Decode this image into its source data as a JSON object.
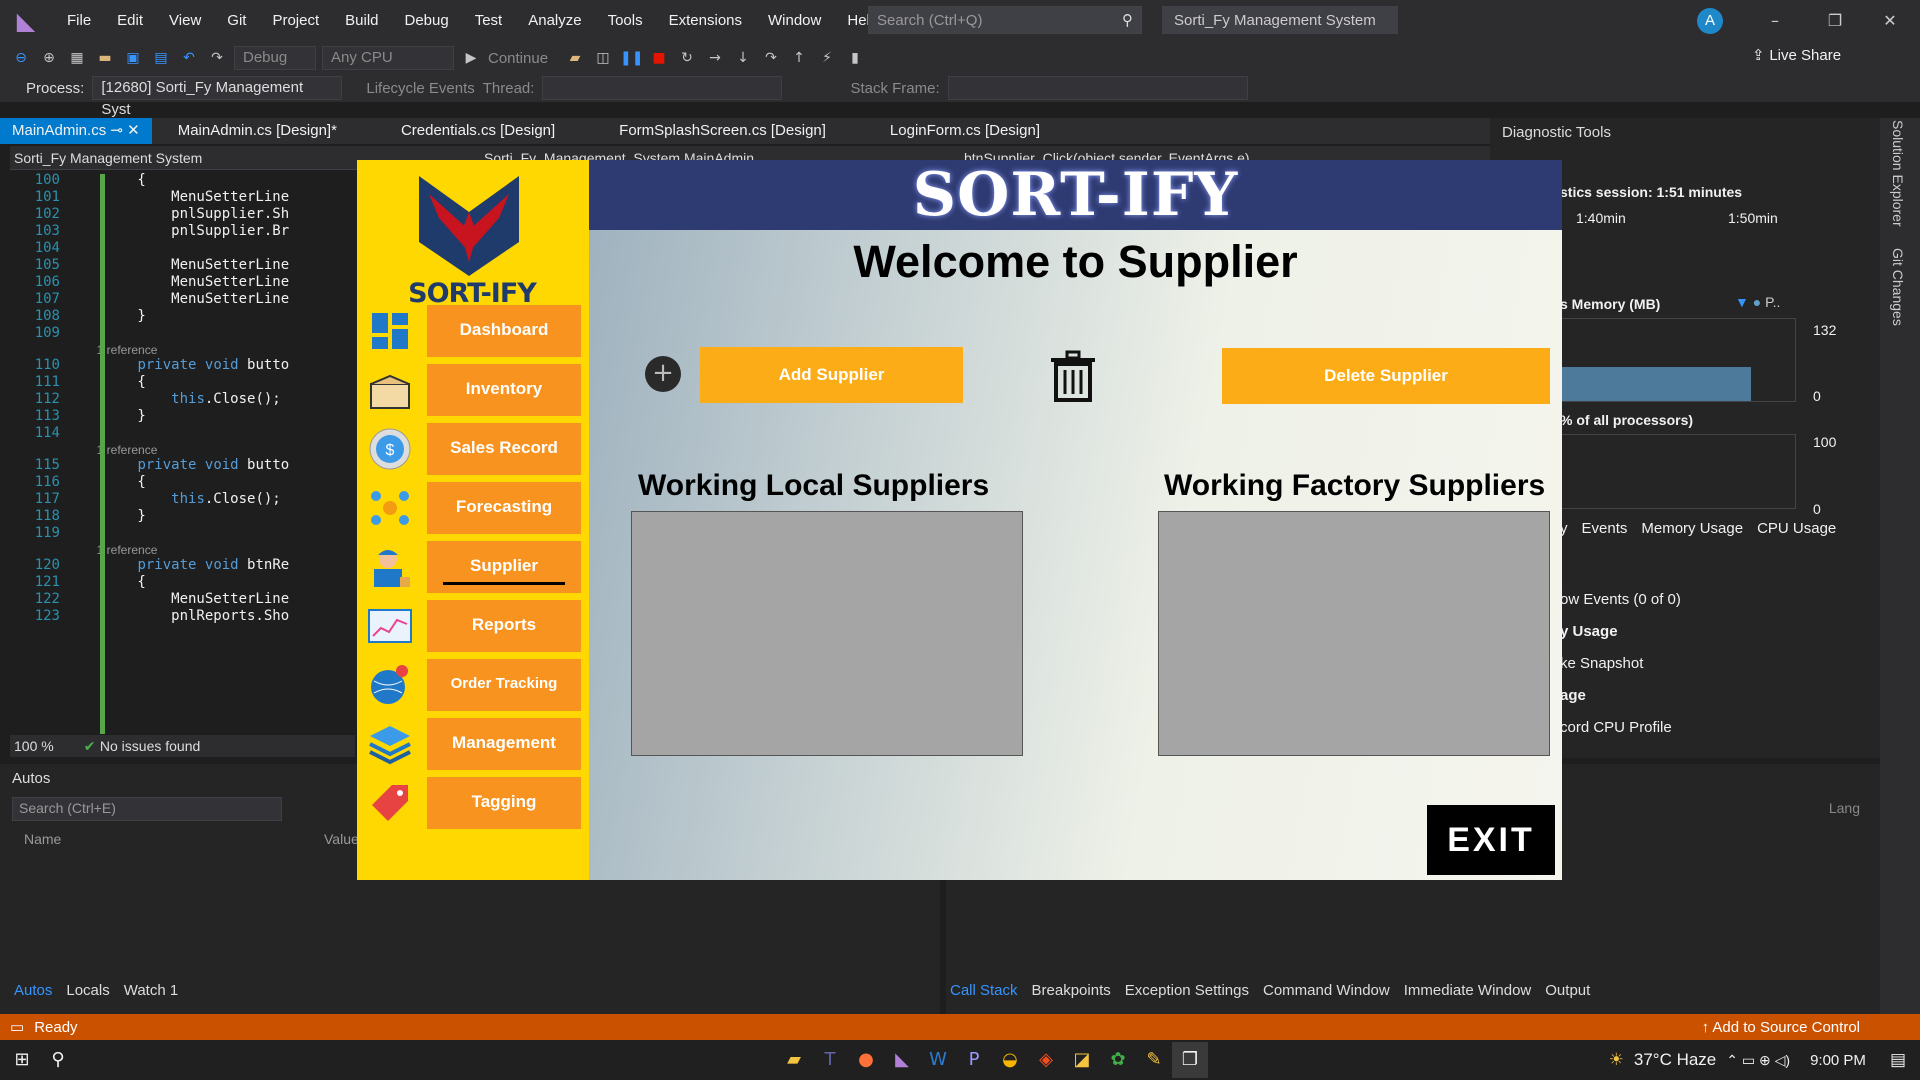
{
  "ide": {
    "menu": [
      "File",
      "Edit",
      "View",
      "Git",
      "Project",
      "Build",
      "Debug",
      "Test",
      "Analyze",
      "Tools",
      "Extensions",
      "Window",
      "Help"
    ],
    "search_placeholder": "Search (Ctrl+Q)",
    "solution_name": "Sorti_Fy Management System",
    "avatar_initial": "A",
    "live_share": "Live Share",
    "toolbar": {
      "config": "Debug",
      "platform": "Any CPU",
      "continue": "Continue"
    },
    "debug_bar": {
      "process_label": "Process:",
      "process_value": "[12680] Sorti_Fy Management Syst",
      "lifecycle": "Lifecycle Events",
      "thread": "Thread:",
      "stack_frame": "Stack Frame:"
    },
    "tabs": [
      "MainAdmin.cs",
      "MainAdmin.cs [Design]*",
      "Credentials.cs [Design]",
      "FormSplashScreen.cs [Design]",
      "LoginForm.cs [Design]"
    ],
    "nav": {
      "project": "Sorti_Fy Management System",
      "class": "Sorti_Fy_Management_System.MainAdmin",
      "member": "btnSupplier_Click(object sender, EventArgs e)"
    },
    "code": [
      {
        "n": "100",
        "t": "        {"
      },
      {
        "n": "101",
        "t": "            MenuSetterLine"
      },
      {
        "n": "102",
        "t": "            pnlSupplier.Sh"
      },
      {
        "n": "103",
        "t": "            pnlSupplier.Br"
      },
      {
        "n": "104",
        "t": ""
      },
      {
        "n": "105",
        "t": "            MenuSetterLine"
      },
      {
        "n": "106",
        "t": "            MenuSetterLine"
      },
      {
        "n": "107",
        "t": "            MenuSetterLine"
      },
      {
        "n": "108",
        "t": "        }"
      },
      {
        "n": "109",
        "t": ""
      },
      {
        "n": "110",
        "t": "        private void butto"
      },
      {
        "n": "111",
        "t": "        {"
      },
      {
        "n": "112",
        "t": "            this.Close();"
      },
      {
        "n": "113",
        "t": "        }"
      },
      {
        "n": "114",
        "t": ""
      },
      {
        "n": "115",
        "t": "        private void butto"
      },
      {
        "n": "116",
        "t": "        {"
      },
      {
        "n": "117",
        "t": "            this.Close();"
      },
      {
        "n": "118",
        "t": "        }"
      },
      {
        "n": "119",
        "t": ""
      },
      {
        "n": "120",
        "t": "        private void btnRe"
      },
      {
        "n": "121",
        "t": "        {"
      },
      {
        "n": "122",
        "t": "            MenuSetterLine"
      },
      {
        "n": "123",
        "t": "            pnlReports.Sho"
      }
    ],
    "ref_label": "1 reference",
    "zoom": "100 %",
    "issues": "No issues found",
    "autos": {
      "title": "Autos",
      "search": "Search (Ctrl+E)",
      "col_name": "Name",
      "col_value": "Value",
      "tabs": [
        "Autos",
        "Locals",
        "Watch 1"
      ]
    },
    "diag": {
      "title": "Diagnostic Tools",
      "session": "stics session: 1:51 minutes",
      "t1": "1:40min",
      "t2": "1:50min",
      "memory": "s Memory (MB)",
      "mem_legend": "P..",
      "mem_max": "132",
      "mem_min": "0",
      "cpu": "% of all processors)",
      "cpu_max": "100",
      "cpu_min": "0",
      "tabs": [
        "y",
        "Events",
        "Memory Usage",
        "CPU Usage"
      ],
      "rows": [
        "ow Events (0 of 0)",
        "y Usage",
        "ke Snapshot",
        "age",
        "cord CPU Profile"
      ]
    },
    "bottom_right_tabs": [
      "Call Stack",
      "Breakpoints",
      "Exception Settings",
      "Command Window",
      "Immediate Window",
      "Output"
    ],
    "lang_label": "Lang",
    "side_tabs": [
      "Solution Explorer",
      "Git Changes"
    ],
    "status": {
      "ready": "Ready",
      "source_control": "Add to Source Control"
    },
    "taskbar": {
      "weather": "37°C  Haze",
      "time": "9:00 PM"
    }
  },
  "app": {
    "header_title": "SORT-IFY",
    "logo_text": "SORT-IFY",
    "nav": [
      {
        "label": "Dashboard",
        "icon": "dashboard-icon"
      },
      {
        "label": "Inventory",
        "icon": "box-icon"
      },
      {
        "label": "Sales Record",
        "icon": "dollar-icon"
      },
      {
        "label": "Forecasting",
        "icon": "network-icon"
      },
      {
        "label": "Supplier",
        "icon": "worker-icon"
      },
      {
        "label": "Reports",
        "icon": "chart-icon"
      },
      {
        "label": "Order Tracking",
        "icon": "globe-icon"
      },
      {
        "label": "Management",
        "icon": "layers-icon"
      },
      {
        "label": "Tagging",
        "icon": "tag-icon"
      }
    ],
    "active_nav": "Supplier",
    "welcome": "Welcome to Supplier",
    "add_supplier": "Add Supplier",
    "delete_supplier": "Delete Supplier",
    "local_title": "Working Local Suppliers",
    "factory_title": "Working Factory Suppliers",
    "exit_label": "EXIT",
    "colors": {
      "sidebar": "#fed800",
      "nav_button": "#f7931e",
      "header": "#2e3a72",
      "action_button": "#fbac17"
    }
  }
}
